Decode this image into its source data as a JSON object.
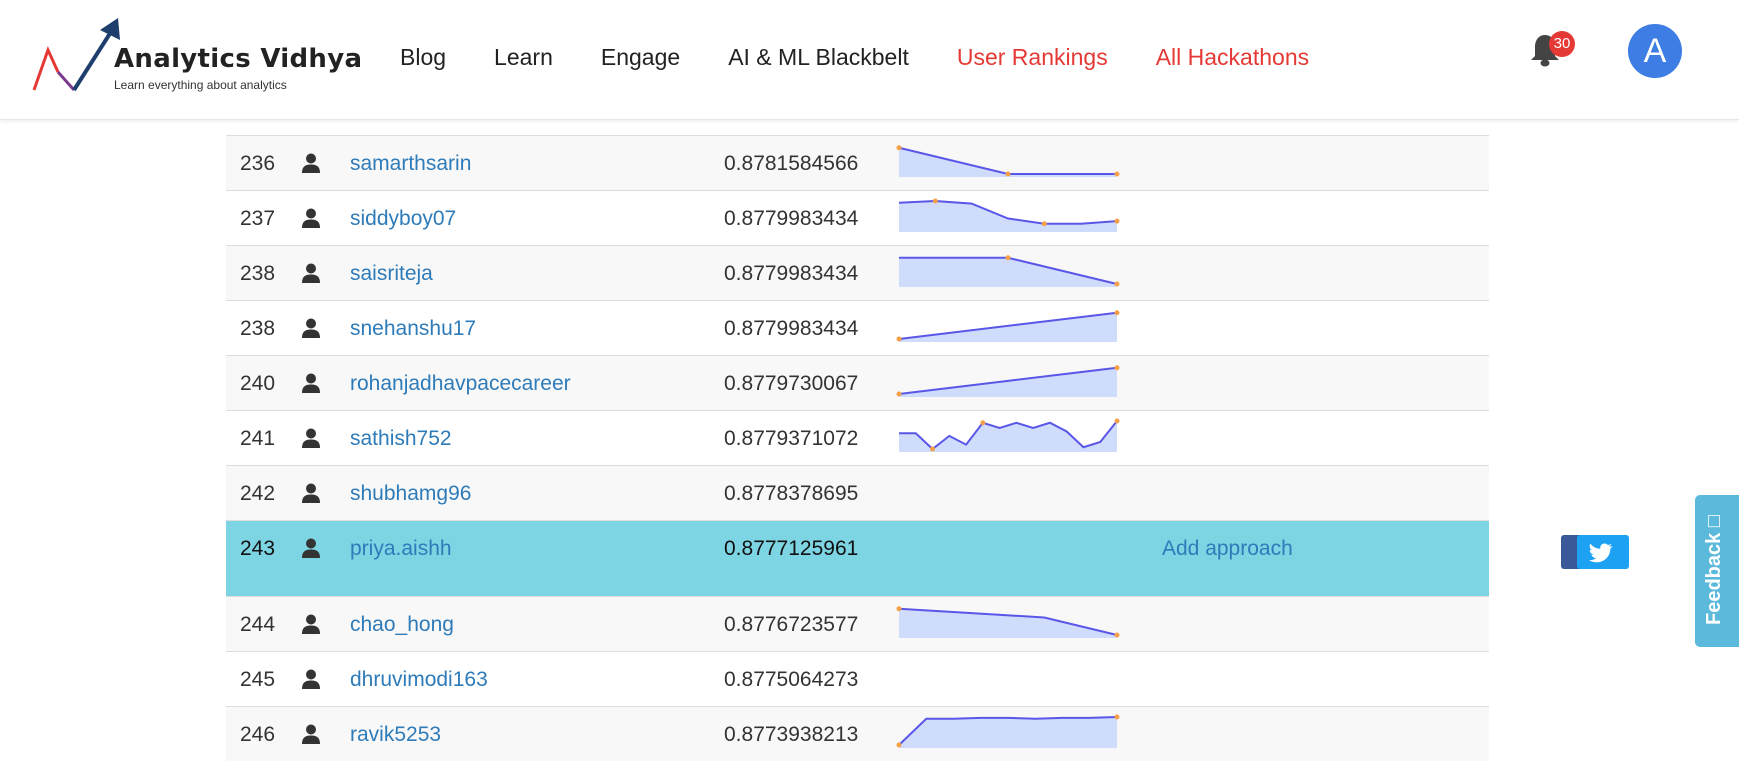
{
  "header": {
    "logo_name": "Analytics Vidhya",
    "logo_tagline": "Learn everything about analytics",
    "nav": [
      {
        "label": "Blog",
        "accent": false
      },
      {
        "label": "Learn",
        "accent": false
      },
      {
        "label": "Engage",
        "accent": false
      },
      {
        "label": "AI & ML Blackbelt",
        "accent": false
      },
      {
        "label": "User Rankings",
        "accent": true
      },
      {
        "label": "All Hackathons",
        "accent": true
      }
    ],
    "notification_count": "30",
    "avatar_letter": "A"
  },
  "colors": {
    "accent_red": "#e53935",
    "link_blue": "#2e7bb9",
    "highlight_row": "#7dd5e4",
    "spark_line": "#5a56e8",
    "spark_fill": "#cfdcfb",
    "spark_point": "#f5a048"
  },
  "leaderboard": {
    "rows": [
      {
        "rank": "236",
        "user": "samarthsarin",
        "score": "0.8781584566",
        "trend": [
          4,
          1,
          1
        ],
        "points": [
          0,
          1,
          2
        ],
        "highlight": false,
        "approach": ""
      },
      {
        "rank": "237",
        "user": "siddyboy07",
        "score": "0.8779983434",
        "trend": [
          4,
          4.2,
          3.9,
          2.2,
          1.6,
          1.6,
          1.9
        ],
        "points": [
          1,
          4,
          6
        ],
        "highlight": false,
        "approach": ""
      },
      {
        "rank": "238",
        "user": "saisriteja",
        "score": "0.8779983434",
        "trend": [
          4,
          4,
          1
        ],
        "points": [
          1,
          2
        ],
        "highlight": false,
        "approach": ""
      },
      {
        "rank": "238",
        "user": "snehanshu17",
        "score": "0.8779983434",
        "trend": [
          1,
          4
        ],
        "points": [
          0,
          1
        ],
        "highlight": false,
        "approach": ""
      },
      {
        "rank": "240",
        "user": "rohanjadhavpacecareer",
        "score": "0.8779730067",
        "trend": [
          1,
          4
        ],
        "points": [
          0,
          1
        ],
        "highlight": false,
        "approach": ""
      },
      {
        "rank": "241",
        "user": "sathish752",
        "score": "0.8779371072",
        "trend": [
          2.8,
          2.8,
          1,
          2.5,
          1.5,
          4,
          3.4,
          4,
          3.4,
          4,
          3,
          1.2,
          1.8,
          4.2
        ],
        "points": [
          2,
          5,
          13
        ],
        "highlight": false,
        "approach": ""
      },
      {
        "rank": "242",
        "user": "shubhamg96",
        "score": "0.8778378695",
        "trend": [],
        "points": [],
        "highlight": false,
        "approach": ""
      },
      {
        "rank": "243",
        "user": "priya.aishh",
        "score": "0.8777125961",
        "trend": [],
        "points": [],
        "highlight": true,
        "approach": "Add approach"
      },
      {
        "rank": "244",
        "user": "chao_hong",
        "score": "0.8776723577",
        "trend": [
          4,
          3.5,
          3,
          1
        ],
        "points": [
          0,
          3
        ],
        "highlight": false,
        "approach": ""
      },
      {
        "rank": "245",
        "user": "dhruvimodi163",
        "score": "0.8775064273",
        "trend": [],
        "points": [],
        "highlight": false,
        "approach": ""
      },
      {
        "rank": "246",
        "user": "ravik5253",
        "score": "0.8773938213",
        "trend": [
          1,
          4,
          4,
          4.1,
          4.1,
          4,
          4.1,
          4.1,
          4.2
        ],
        "points": [
          0,
          8
        ],
        "highlight": false,
        "approach": ""
      }
    ]
  },
  "feedback_label": "Feedback",
  "icons": {
    "bell": "bell-icon",
    "user": "user-icon",
    "facebook": "facebook-icon",
    "twitter": "twitter-icon",
    "feedback": "comment-icon"
  }
}
